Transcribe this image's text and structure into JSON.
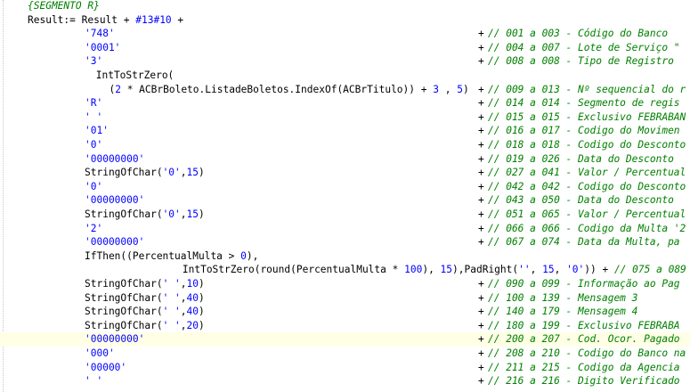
{
  "editor": {
    "colors": {
      "background": "#ffffff",
      "comment": "#008000",
      "string": "#0000ff",
      "number": "#0000ff",
      "plain": "#000000",
      "current_line": "#ffffe6"
    },
    "lines": [
      {
        "segs": [
          {
            "t": "{SEGMENTO R}",
            "k": "comment"
          }
        ]
      },
      {
        "segs": [
          {
            "t": "Result:= Result + ",
            "k": "plain"
          },
          {
            "t": "#13#10",
            "k": "number"
          },
          {
            "t": " +",
            "k": "plain"
          }
        ]
      },
      {
        "segs": [
          {
            "t": "'748'",
            "k": "string"
          }
        ],
        "plus": "+",
        "comment": "// 001 a 003 - Código do Banco"
      },
      {
        "segs": [
          {
            "t": "'0001'",
            "k": "string"
          }
        ],
        "plus": "+",
        "comment": "// 004 a 007 - Lote de Serviço \""
      },
      {
        "segs": [
          {
            "t": "'3'",
            "k": "string"
          }
        ],
        "plus": "+",
        "comment": "// 008 a 008 - Tipo de Registro"
      },
      {
        "segs": [
          {
            "t": " IntToStrZero(",
            "k": "plain"
          }
        ]
      },
      {
        "segs": [
          {
            "t": "  (",
            "k": "plain"
          },
          {
            "t": "2",
            "k": "number"
          },
          {
            "t": " * ACBrBoleto.ListadeBoletos.IndexOf(ACBrTitulo)) + ",
            "k": "plain"
          },
          {
            "t": "3",
            "k": "number"
          },
          {
            "t": " , ",
            "k": "plain"
          },
          {
            "t": "5",
            "k": "number"
          },
          {
            "t": ")",
            "k": "plain"
          }
        ],
        "plus": "+",
        "comment": "// 009 a 013 - Nº sequencial do r"
      },
      {
        "segs": [
          {
            "t": "'R'",
            "k": "string"
          }
        ],
        "plus": "+",
        "comment": "// 014 a 014 - Segmento de regis"
      },
      {
        "segs": [
          {
            "t": "' '",
            "k": "string"
          }
        ],
        "plus": "+",
        "comment": "// 015 a 015 - Exclusivo FEBRABAN"
      },
      {
        "segs": [
          {
            "t": "'01'",
            "k": "string"
          }
        ],
        "plus": "+",
        "comment": "// 016 a 017 - Codigo do Movimen"
      },
      {
        "segs": [
          {
            "t": "'0'",
            "k": "string"
          }
        ],
        "plus": "+",
        "comment": "// 018 a 018 - Codigo do Desconto"
      },
      {
        "segs": [
          {
            "t": "'00000000'",
            "k": "string"
          }
        ],
        "plus": "+",
        "comment": "// 019 a 026 - Data do Desconto"
      },
      {
        "segs": [
          {
            "t": "StringOfChar(",
            "k": "plain"
          },
          {
            "t": "'0'",
            "k": "string"
          },
          {
            "t": ",",
            "k": "plain"
          },
          {
            "t": "15",
            "k": "number"
          },
          {
            "t": ")",
            "k": "plain"
          }
        ],
        "plus": "+",
        "comment": "// 027 a 041 - Valor / Percentual"
      },
      {
        "segs": [
          {
            "t": "'0'",
            "k": "string"
          }
        ],
        "plus": "+",
        "comment": "// 042 a 042 - Codigo do Desconto"
      },
      {
        "segs": [
          {
            "t": "'00000000'",
            "k": "string"
          }
        ],
        "plus": "+",
        "comment": "// 043 a 050 - Data do Desconto"
      },
      {
        "segs": [
          {
            "t": "StringOfChar(",
            "k": "plain"
          },
          {
            "t": "'0'",
            "k": "string"
          },
          {
            "t": ",",
            "k": "plain"
          },
          {
            "t": "15",
            "k": "number"
          },
          {
            "t": ")",
            "k": "plain"
          }
        ],
        "plus": "+",
        "comment": "// 051 a 065 - Valor / Percentual"
      },
      {
        "segs": [
          {
            "t": "'2'",
            "k": "string"
          }
        ],
        "plus": "+",
        "comment": "// 066 a 066 - Codigo da Multa '2"
      },
      {
        "segs": [
          {
            "t": "'00000000'",
            "k": "string"
          }
        ],
        "plus": "+",
        "comment": "// 067 a 074 - Data da Multa, pa"
      },
      {
        "segs": [
          {
            "t": "IfThen((PercentualMulta > ",
            "k": "plain"
          },
          {
            "t": "0",
            "k": "number"
          },
          {
            "t": "),",
            "k": "plain"
          }
        ]
      },
      {
        "segs": [
          {
            "t": "        IntToStrZero(round(PercentualMulta * ",
            "k": "plain"
          },
          {
            "t": "100",
            "k": "number"
          },
          {
            "t": "), ",
            "k": "plain"
          },
          {
            "t": "15",
            "k": "number"
          },
          {
            "t": "),PadRight(",
            "k": "plain"
          },
          {
            "t": "''",
            "k": "string"
          },
          {
            "t": ", ",
            "k": "plain"
          },
          {
            "t": "15",
            "k": "number"
          },
          {
            "t": ", ",
            "k": "plain"
          },
          {
            "t": "'0'",
            "k": "string"
          },
          {
            "t": ")) + ",
            "k": "plain"
          },
          {
            "t": "// 075 a 089  -  '",
            "k": "comment"
          }
        ]
      },
      {
        "segs": [
          {
            "t": "StringOfChar(",
            "k": "plain"
          },
          {
            "t": "' '",
            "k": "string"
          },
          {
            "t": ",",
            "k": "plain"
          },
          {
            "t": "10",
            "k": "number"
          },
          {
            "t": ")",
            "k": "plain"
          }
        ],
        "plus": "+",
        "comment": "// 090 a 099 - Informação ao Pag"
      },
      {
        "segs": [
          {
            "t": "StringOfChar(",
            "k": "plain"
          },
          {
            "t": "' '",
            "k": "string"
          },
          {
            "t": ",",
            "k": "plain"
          },
          {
            "t": "40",
            "k": "number"
          },
          {
            "t": ")",
            "k": "plain"
          }
        ],
        "plus": "+",
        "comment": "// 100 a 139 - Mensagem 3"
      },
      {
        "segs": [
          {
            "t": "StringOfChar(",
            "k": "plain"
          },
          {
            "t": "' '",
            "k": "string"
          },
          {
            "t": ",",
            "k": "plain"
          },
          {
            "t": "40",
            "k": "number"
          },
          {
            "t": ")",
            "k": "plain"
          }
        ],
        "plus": "+",
        "comment": "// 140 a 179 - Mensagem 4"
      },
      {
        "segs": [
          {
            "t": "StringOfChar(",
            "k": "plain"
          },
          {
            "t": "' '",
            "k": "string"
          },
          {
            "t": ",",
            "k": "plain"
          },
          {
            "t": "20",
            "k": "number"
          },
          {
            "t": ")",
            "k": "plain"
          }
        ],
        "plus": "+",
        "comment": "// 180 a 199 - Exclusivo FEBRABA"
      },
      {
        "segs": [
          {
            "t": "'00000000'",
            "k": "string"
          }
        ],
        "plus": "+",
        "comment": "// 200 a 207 - Cod. Ocor. Pagado",
        "current": true
      },
      {
        "segs": [
          {
            "t": "'000'",
            "k": "string"
          }
        ],
        "plus": "+",
        "comment": "// 208 a 210 - Codigo do Banco na"
      },
      {
        "segs": [
          {
            "t": "'00000'",
            "k": "string"
          }
        ],
        "plus": "+",
        "comment": "// 211 a 215 - Codigo da Agencia"
      },
      {
        "segs": [
          {
            "t": "' '",
            "k": "string"
          }
        ],
        "plus": "+",
        "comment": "// 216 a 216 - Digito Verificado"
      }
    ]
  }
}
